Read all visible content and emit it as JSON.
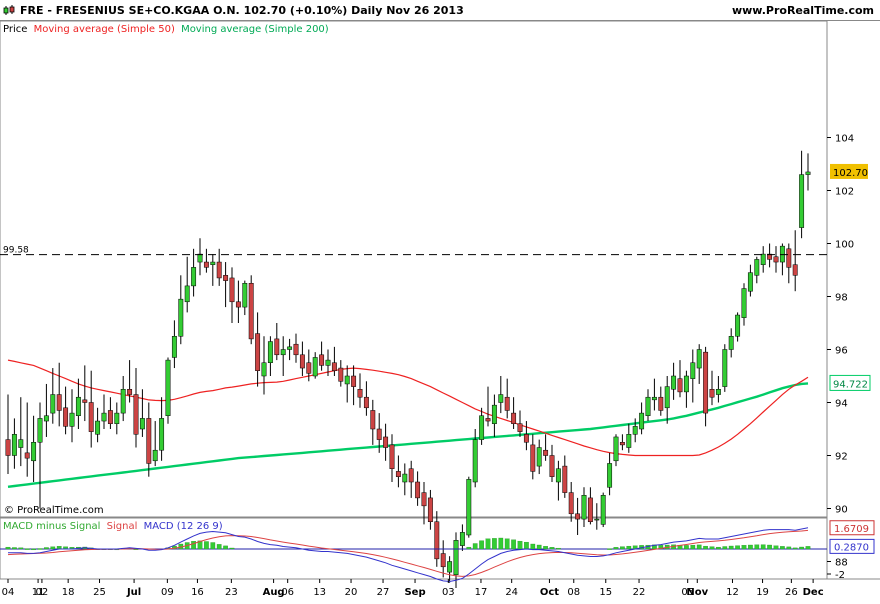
{
  "header": {
    "title": "FRE - FRESENIUS SE+CO.KGAA O.N.    102.70 (+0.10%)    Daily  Nov 26 2013",
    "website": "www.ProRealTime.com"
  },
  "price_legend": {
    "label": "Price",
    "ma50": "Moving average (Simple 50)",
    "ma200": "Moving average (Simple 200)"
  },
  "macd_legend": {
    "label": "MACD minus Signal",
    "signal": "Signal",
    "macd": "MACD (12 26 9)"
  },
  "watermark": "© ProRealTime.com",
  "colors": {
    "up": "#33cc33",
    "down": "#cc4444",
    "ma50": "#ee2222",
    "ma200": "#00cc66",
    "macd": "#3333cc",
    "signal": "#dd4444",
    "hist": "#33cc33",
    "tag_price": "#f0c000"
  },
  "chart_data": [
    {
      "type": "candlestick",
      "title": "FRE - FRESENIUS SE+CO.KGAA O.N.",
      "x": [
        "2013-06-04",
        "2013-06-05",
        "2013-06-06",
        "2013-06-07",
        "2013-06-10",
        "2013-06-11",
        "2013-06-12",
        "2013-06-13",
        "2013-06-14",
        "2013-06-17",
        "2013-06-18",
        "2013-06-19",
        "2013-06-20",
        "2013-06-21",
        "2013-06-24",
        "2013-06-25",
        "2013-06-26",
        "2013-06-27",
        "2013-06-28",
        "2013-07-01",
        "2013-07-02",
        "2013-07-03",
        "2013-07-04",
        "2013-07-05",
        "2013-07-08",
        "2013-07-09",
        "2013-07-10",
        "2013-07-11",
        "2013-07-12",
        "2013-07-15",
        "2013-07-16",
        "2013-07-17",
        "2013-07-18",
        "2013-07-19",
        "2013-07-22",
        "2013-07-23",
        "2013-07-24",
        "2013-07-25",
        "2013-07-26",
        "2013-07-29",
        "2013-07-30",
        "2013-07-31",
        "2013-08-01",
        "2013-08-02",
        "2013-08-05",
        "2013-08-06",
        "2013-08-07",
        "2013-08-08",
        "2013-08-09",
        "2013-08-12",
        "2013-08-13",
        "2013-08-14",
        "2013-08-15",
        "2013-08-16",
        "2013-08-19",
        "2013-08-20",
        "2013-08-21",
        "2013-08-22",
        "2013-08-23",
        "2013-08-26",
        "2013-08-27",
        "2013-08-28",
        "2013-08-29",
        "2013-08-30",
        "2013-09-02",
        "2013-09-03",
        "2013-09-04",
        "2013-09-05",
        "2013-09-06",
        "2013-09-09",
        "2013-09-10",
        "2013-09-11",
        "2013-09-12",
        "2013-09-13",
        "2013-09-16",
        "2013-09-17",
        "2013-09-18",
        "2013-09-19",
        "2013-09-20",
        "2013-09-23",
        "2013-09-24",
        "2013-09-25",
        "2013-09-26",
        "2013-09-27",
        "2013-09-30",
        "2013-10-01",
        "2013-10-02",
        "2013-10-03",
        "2013-10-04",
        "2013-10-07",
        "2013-10-08",
        "2013-10-09",
        "2013-10-10",
        "2013-10-11",
        "2013-10-14",
        "2013-10-15",
        "2013-10-16",
        "2013-10-17",
        "2013-10-18",
        "2013-10-21",
        "2013-10-22",
        "2013-10-23",
        "2013-10-24",
        "2013-10-25",
        "2013-10-28",
        "2013-10-29",
        "2013-10-30",
        "2013-10-31",
        "2013-11-01",
        "2013-11-04",
        "2013-11-05",
        "2013-11-06",
        "2013-11-07",
        "2013-11-08",
        "2013-11-11",
        "2013-11-12",
        "2013-11-13",
        "2013-11-14",
        "2013-11-15",
        "2013-11-18",
        "2013-11-19",
        "2013-11-20",
        "2013-11-21",
        "2013-11-22",
        "2013-11-25",
        "2013-11-26"
      ],
      "open": [
        92.6,
        92.0,
        92.3,
        92.1,
        91.8,
        92.5,
        93.3,
        93.6,
        94.3,
        93.8,
        93.1,
        93.5,
        94.1,
        94.0,
        92.8,
        93.3,
        93.7,
        93.2,
        93.6,
        94.5,
        94.3,
        93.0,
        93.4,
        91.8,
        92.2,
        93.5,
        95.7,
        96.5,
        97.8,
        98.4,
        99.3,
        99.3,
        99.2,
        99.3,
        98.8,
        98.7,
        97.8,
        97.6,
        98.5,
        96.6,
        95.0,
        95.5,
        96.4,
        95.8,
        96.0,
        96.2,
        95.8,
        95.5,
        95.0,
        95.8,
        95.4,
        95.5,
        95.3,
        94.7,
        95.0,
        94.5,
        94.2,
        93.7,
        93.0,
        92.7,
        92.4,
        91.4,
        91.0,
        91.5,
        91.0,
        90.6,
        90.4,
        89.5,
        88.3,
        87.6,
        87.5,
        88.6,
        89.0,
        91.0,
        92.6,
        93.4,
        93.2,
        94.0,
        94.2,
        93.6,
        93.2,
        92.8,
        92.4,
        91.6,
        92.2,
        92.0,
        91.0,
        91.6,
        90.6,
        89.8,
        89.6,
        90.4,
        89.6,
        89.4,
        90.8,
        91.8,
        92.5,
        92.3,
        92.8,
        93.0,
        93.5,
        94.1,
        94.2,
        93.8,
        94.5,
        94.9,
        94.4,
        94.9,
        95.3,
        95.9,
        94.5,
        94.3,
        94.6,
        96.0,
        96.5,
        97.2,
        98.2,
        98.8,
        99.2,
        99.6,
        99.5,
        99.3,
        99.8,
        99.2,
        100.6,
        102.6
      ],
      "high": [
        94.3,
        93.4,
        94.2,
        94.0,
        93.5,
        94.0,
        94.7,
        95.3,
        95.5,
        94.6,
        94.5,
        94.9,
        95.4,
        95.2,
        93.8,
        94.3,
        94.2,
        94.0,
        95.0,
        95.6,
        95.3,
        94.5,
        94.0,
        93.3,
        94.2,
        95.7,
        97.1,
        98.8,
        99.5,
        99.8,
        100.2,
        99.8,
        99.6,
        99.8,
        99.3,
        99.1,
        98.6,
        98.6,
        98.8,
        97.4,
        96.5,
        96.5,
        97.0,
        96.5,
        96.4,
        96.6,
        96.3,
        96.0,
        95.9,
        96.3,
        96.0,
        96.1,
        95.6,
        95.4,
        95.4,
        95.1,
        94.8,
        94.1,
        93.6,
        93.2,
        92.8,
        92.0,
        91.7,
        91.8,
        91.4,
        91.0,
        90.7,
        89.9,
        88.8,
        88.2,
        89.1,
        89.4,
        91.2,
        93.0,
        93.8,
        94.6,
        94.3,
        95.0,
        94.9,
        94.2,
        93.7,
        93.3,
        92.8,
        92.6,
        92.8,
        92.4,
        91.8,
        92.0,
        91.0,
        90.4,
        90.8,
        90.8,
        90.2,
        90.6,
        92.1,
        92.8,
        92.8,
        93.2,
        93.4,
        94.0,
        94.5,
        94.9,
        94.6,
        95.0,
        95.5,
        95.6,
        95.2,
        96.0,
        96.2,
        96.1,
        95.2,
        95.0,
        96.2,
        96.8,
        97.4,
        98.5,
        99.2,
        99.5,
        99.9,
        100.0,
        99.9,
        100.0,
        100.0,
        100.5,
        103.5,
        103.4
      ],
      "low": [
        91.3,
        91.5,
        91.6,
        91.2,
        91.0,
        90.0,
        92.7,
        93.2,
        93.1,
        92.8,
        92.5,
        93.0,
        93.3,
        92.3,
        92.5,
        93.0,
        93.0,
        92.8,
        93.3,
        94.0,
        92.3,
        92.7,
        91.2,
        91.6,
        91.8,
        93.2,
        95.3,
        96.2,
        97.4,
        98.0,
        98.8,
        98.9,
        98.4,
        98.4,
        97.6,
        97.0,
        97.0,
        97.3,
        96.2,
        94.6,
        94.3,
        95.0,
        95.6,
        95.0,
        95.6,
        95.5,
        95.0,
        94.8,
        94.9,
        95.2,
        95.0,
        95.0,
        94.6,
        94.0,
        93.9,
        93.8,
        93.5,
        92.4,
        92.1,
        91.8,
        91.0,
        90.8,
        90.5,
        90.4,
        90.1,
        89.4,
        89.2,
        87.8,
        87.4,
        87.2,
        87.0,
        88.4,
        88.9,
        90.8,
        92.4,
        93.1,
        92.7,
        93.6,
        93.4,
        93.0,
        92.7,
        92.2,
        91.1,
        91.3,
        91.8,
        91.0,
        90.3,
        90.4,
        89.5,
        89.0,
        89.3,
        89.4,
        89.2,
        89.3,
        90.5,
        91.6,
        92.2,
        92.1,
        92.5,
        92.8,
        93.3,
        93.7,
        93.5,
        93.2,
        94.1,
        94.2,
        93.8,
        94.0,
        94.7,
        93.1,
        93.9,
        94.0,
        94.4,
        95.7,
        96.3,
        96.9,
        98.0,
        98.5,
        98.9,
        99.1,
        98.9,
        98.8,
        98.5,
        98.2,
        100.2,
        102.0
      ],
      "close": [
        92.0,
        92.8,
        92.6,
        91.9,
        92.5,
        93.4,
        93.5,
        94.3,
        93.7,
        93.1,
        93.6,
        94.2,
        94.0,
        92.9,
        93.3,
        93.6,
        93.2,
        93.6,
        94.5,
        94.3,
        92.8,
        93.4,
        91.7,
        92.2,
        93.4,
        95.6,
        96.5,
        97.9,
        98.4,
        99.1,
        99.6,
        99.1,
        99.3,
        98.7,
        98.6,
        97.8,
        97.6,
        98.5,
        96.4,
        95.2,
        95.5,
        96.3,
        95.8,
        96.0,
        96.1,
        95.8,
        95.3,
        95.1,
        95.7,
        95.4,
        95.6,
        95.2,
        94.8,
        95.0,
        94.6,
        94.2,
        93.8,
        93.0,
        92.6,
        92.3,
        91.5,
        91.2,
        91.3,
        91.0,
        90.4,
        90.1,
        89.5,
        88.1,
        87.8,
        88.0,
        88.8,
        89.1,
        91.1,
        92.6,
        93.5,
        93.3,
        93.9,
        94.3,
        93.7,
        93.2,
        92.9,
        92.5,
        91.4,
        92.3,
        92.0,
        91.2,
        91.5,
        90.6,
        89.8,
        89.6,
        90.5,
        89.5,
        89.6,
        90.5,
        91.7,
        92.7,
        92.4,
        92.8,
        93.1,
        93.6,
        94.2,
        94.2,
        93.7,
        94.6,
        95.0,
        94.4,
        95.0,
        95.5,
        96.0,
        93.6,
        94.2,
        94.5,
        96.0,
        96.5,
        97.3,
        98.3,
        98.9,
        99.4,
        99.6,
        99.4,
        99.3,
        99.9,
        99.1,
        98.8,
        102.6,
        102.7
      ],
      "ma50": [
        95.6,
        95.55,
        95.5,
        95.45,
        95.4,
        95.3,
        95.2,
        95.1,
        95.0,
        94.9,
        94.8,
        94.7,
        94.62,
        94.55,
        94.5,
        94.45,
        94.4,
        94.35,
        94.3,
        94.25,
        94.2,
        94.15,
        94.1,
        94.08,
        94.07,
        94.08,
        94.12,
        94.18,
        94.25,
        94.32,
        94.38,
        94.42,
        94.45,
        94.5,
        94.55,
        94.58,
        94.62,
        94.66,
        94.7,
        94.73,
        94.75,
        94.76,
        94.77,
        94.8,
        94.85,
        94.9,
        94.95,
        95.0,
        95.05,
        95.1,
        95.15,
        95.2,
        95.25,
        95.28,
        95.3,
        95.28,
        95.25,
        95.22,
        95.18,
        95.14,
        95.1,
        95.05,
        94.98,
        94.9,
        94.8,
        94.7,
        94.6,
        94.48,
        94.36,
        94.24,
        94.12,
        94.0,
        93.88,
        93.76,
        93.66,
        93.56,
        93.48,
        93.4,
        93.32,
        93.24,
        93.16,
        93.08,
        93.0,
        92.92,
        92.84,
        92.76,
        92.68,
        92.6,
        92.52,
        92.44,
        92.36,
        92.29,
        92.22,
        92.16,
        92.11,
        92.07,
        92.04,
        92.02,
        92.0,
        92.0,
        92.0,
        92.0,
        92.0,
        92.0,
        92.0,
        92.0,
        92.0,
        92.0,
        92.02,
        92.1,
        92.2,
        92.32,
        92.46,
        92.62,
        92.8,
        93.0,
        93.2,
        93.42,
        93.64,
        93.86,
        94.08,
        94.3,
        94.5,
        94.66,
        94.8,
        94.95
      ],
      "ma200": [
        90.82,
        90.85,
        90.88,
        90.91,
        90.94,
        90.97,
        91.0,
        91.03,
        91.06,
        91.09,
        91.12,
        91.15,
        91.18,
        91.21,
        91.24,
        91.27,
        91.3,
        91.33,
        91.36,
        91.39,
        91.42,
        91.45,
        91.48,
        91.51,
        91.54,
        91.57,
        91.6,
        91.63,
        91.66,
        91.69,
        91.72,
        91.75,
        91.78,
        91.81,
        91.84,
        91.87,
        91.9,
        91.92,
        91.94,
        91.96,
        91.98,
        92.0,
        92.02,
        92.04,
        92.06,
        92.08,
        92.1,
        92.12,
        92.14,
        92.16,
        92.18,
        92.2,
        92.22,
        92.24,
        92.26,
        92.28,
        92.3,
        92.32,
        92.34,
        92.36,
        92.38,
        92.4,
        92.42,
        92.44,
        92.46,
        92.48,
        92.5,
        92.52,
        92.54,
        92.56,
        92.58,
        92.6,
        92.62,
        92.64,
        92.66,
        92.68,
        92.7,
        92.72,
        92.74,
        92.76,
        92.78,
        92.8,
        92.82,
        92.84,
        92.86,
        92.88,
        92.9,
        92.92,
        92.94,
        92.96,
        92.98,
        93.0,
        93.03,
        93.06,
        93.09,
        93.12,
        93.15,
        93.18,
        93.21,
        93.24,
        93.27,
        93.3,
        93.33,
        93.36,
        93.4,
        93.45,
        93.5,
        93.56,
        93.62,
        93.68,
        93.74,
        93.8,
        93.87,
        93.94,
        94.01,
        94.08,
        94.15,
        94.22,
        94.3,
        94.38,
        94.46,
        94.54,
        94.6,
        94.66,
        94.7,
        94.72
      ],
      "price_ticks": [
        88,
        90,
        92,
        94,
        96,
        98,
        100,
        102,
        104
      ],
      "x_tick_labels": [
        "04",
        "11",
        "18",
        "25",
        "Jul",
        "02",
        "09",
        "16",
        "23",
        "Aug",
        "06",
        "13",
        "20",
        "27",
        "Sep",
        "03",
        "10",
        "17",
        "24",
        "Oct",
        "08",
        "15",
        "22",
        "Nov",
        "05",
        "12",
        "19",
        "26",
        "Dec"
      ],
      "horizontal_line": {
        "value": 99.58,
        "label": "99.58"
      },
      "last_price_tag": "102.70",
      "ma200_tag": "94.722"
    },
    {
      "type": "macd",
      "title": "MACD (12 26 9)",
      "macd": [
        -0.3,
        -0.3,
        -0.3,
        -0.35,
        -0.35,
        -0.3,
        -0.2,
        -0.1,
        0.0,
        0.0,
        0.0,
        0.05,
        0.1,
        0.05,
        0.0,
        0.0,
        0.0,
        0.0,
        0.05,
        0.1,
        0.05,
        0.0,
        -0.1,
        -0.1,
        -0.05,
        0.1,
        0.3,
        0.55,
        0.8,
        1.05,
        1.25,
        1.35,
        1.4,
        1.35,
        1.3,
        1.15,
        1.0,
        0.95,
        0.8,
        0.6,
        0.45,
        0.35,
        0.3,
        0.2,
        0.15,
        0.1,
        0.0,
        -0.1,
        -0.15,
        -0.2,
        -0.2,
        -0.25,
        -0.3,
        -0.35,
        -0.45,
        -0.55,
        -0.65,
        -0.8,
        -0.95,
        -1.1,
        -1.3,
        -1.45,
        -1.6,
        -1.75,
        -1.9,
        -2.05,
        -2.2,
        -2.4,
        -2.55,
        -2.6,
        -2.5,
        -2.35,
        -2.0,
        -1.6,
        -1.2,
        -0.85,
        -0.6,
        -0.35,
        -0.2,
        -0.1,
        -0.05,
        0.0,
        -0.05,
        -0.05,
        -0.1,
        -0.15,
        -0.2,
        -0.3,
        -0.4,
        -0.5,
        -0.55,
        -0.6,
        -0.6,
        -0.55,
        -0.45,
        -0.3,
        -0.2,
        -0.1,
        0.0,
        0.1,
        0.2,
        0.3,
        0.35,
        0.45,
        0.55,
        0.6,
        0.65,
        0.75,
        0.85,
        0.8,
        0.8,
        0.8,
        0.9,
        1.0,
        1.1,
        1.2,
        1.3,
        1.4,
        1.5,
        1.55,
        1.55,
        1.55,
        1.55,
        1.5,
        1.6,
        1.7
      ],
      "signal": [
        -0.45,
        -0.42,
        -0.4,
        -0.38,
        -0.36,
        -0.34,
        -0.32,
        -0.28,
        -0.22,
        -0.18,
        -0.14,
        -0.1,
        -0.06,
        -0.04,
        -0.03,
        -0.02,
        -0.02,
        -0.01,
        0.0,
        0.02,
        0.03,
        0.02,
        0.0,
        -0.02,
        -0.03,
        0.0,
        0.06,
        0.15,
        0.28,
        0.43,
        0.6,
        0.75,
        0.88,
        0.98,
        1.05,
        1.07,
        1.06,
        1.04,
        1.0,
        0.92,
        0.83,
        0.73,
        0.64,
        0.55,
        0.47,
        0.4,
        0.32,
        0.23,
        0.16,
        0.08,
        0.02,
        -0.04,
        -0.1,
        -0.16,
        -0.22,
        -0.29,
        -0.36,
        -0.45,
        -0.55,
        -0.66,
        -0.79,
        -0.92,
        -1.06,
        -1.2,
        -1.34,
        -1.48,
        -1.63,
        -1.78,
        -1.93,
        -2.06,
        -2.15,
        -2.19,
        -2.15,
        -2.04,
        -1.87,
        -1.67,
        -1.45,
        -1.23,
        -1.02,
        -0.84,
        -0.68,
        -0.55,
        -0.45,
        -0.37,
        -0.32,
        -0.29,
        -0.27,
        -0.28,
        -0.3,
        -0.34,
        -0.38,
        -0.42,
        -0.46,
        -0.48,
        -0.48,
        -0.44,
        -0.39,
        -0.33,
        -0.26,
        -0.19,
        -0.11,
        -0.03,
        0.05,
        0.13,
        0.21,
        0.29,
        0.36,
        0.44,
        0.52,
        0.57,
        0.61,
        0.65,
        0.7,
        0.76,
        0.83,
        0.9,
        0.98,
        1.06,
        1.15,
        1.23,
        1.29,
        1.34,
        1.38,
        1.41,
        1.44,
        1.49
      ],
      "y_tick_labels": [
        "-2"
      ],
      "macd_tag": "1.6709",
      "hist_tag": "0.2870"
    }
  ]
}
